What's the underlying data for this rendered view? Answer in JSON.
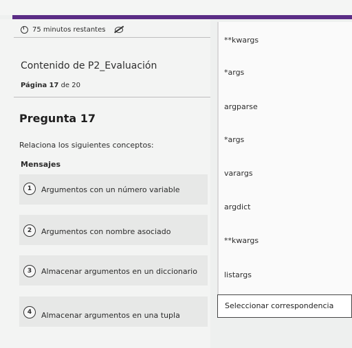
{
  "timer": {
    "text": "75 minutos restantes"
  },
  "content": {
    "title": "Contenido de P2_Evaluación"
  },
  "page": {
    "label": "Página",
    "current": "17",
    "of": "de 20"
  },
  "question": {
    "title": "Pregunta 17",
    "instruction": "Relaciona los siguientes conceptos:",
    "messages_label": "Mensajes"
  },
  "messages": [
    {
      "num": "1",
      "text": "Argumentos con un número variable"
    },
    {
      "num": "2",
      "text": "Argumentos con nombre asociado"
    },
    {
      "num": "3",
      "text": "Almacenar argumentos en un diccionario"
    },
    {
      "num": "4",
      "text": "Almacenar argumentos en una tupla"
    }
  ],
  "options": [
    "**kwargs",
    "*args",
    "argparse",
    "*args",
    "varargs",
    "argdict",
    "**kwargs",
    "listargs"
  ],
  "select": {
    "label": "Seleccionar correspondencia"
  },
  "colors": {
    "accent": "#5b2d86"
  }
}
